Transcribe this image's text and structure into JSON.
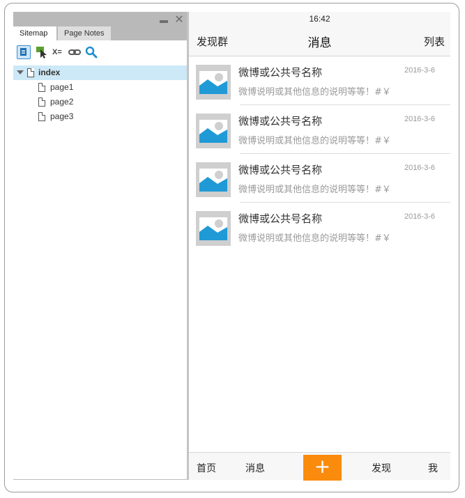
{
  "sitemap_panel": {
    "tabs": [
      "Sitemap",
      "Page Notes"
    ],
    "toolbar": {
      "variable_label": "X="
    },
    "tree": {
      "root": "index",
      "children": [
        "page1",
        "page2",
        "page3"
      ]
    }
  },
  "phone": {
    "status_time": "16:42",
    "nav": {
      "left": "发现群",
      "title": "消息",
      "right": "列表"
    },
    "items": [
      {
        "title": "微博或公共号名称",
        "date": "2016-3-6",
        "desc": "微博说明或其他信息的说明等等！#￥"
      },
      {
        "title": "微博或公共号名称",
        "date": "2016-3-6",
        "desc": "微博说明或其他信息的说明等等！#￥"
      },
      {
        "title": "微博或公共号名称",
        "date": "2016-3-6",
        "desc": "微博说明或其他信息的说明等等！#￥"
      },
      {
        "title": "微博或公共号名称",
        "date": "2016-3-6",
        "desc": "微博说明或其他信息的说明等等！#￥"
      }
    ],
    "tabbar": {
      "home": "首页",
      "messages": "消息",
      "plus": "+",
      "discover": "发现",
      "me": "我"
    },
    "colors": {
      "accent": "#fa8b0c",
      "image_blue": "#1f9ad6"
    }
  }
}
